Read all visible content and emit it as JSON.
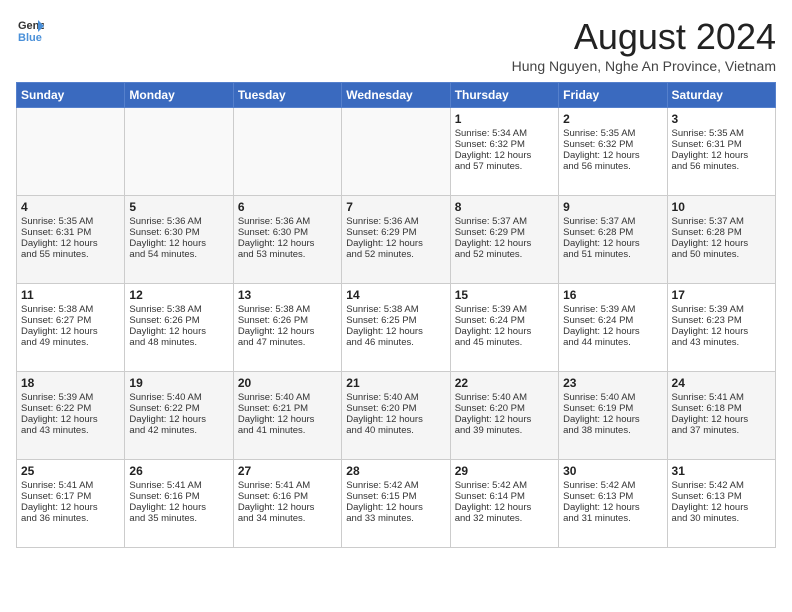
{
  "header": {
    "logo_line1": "General",
    "logo_line2": "Blue",
    "title": "August 2024",
    "subtitle": "Hung Nguyen, Nghe An Province, Vietnam"
  },
  "weekdays": [
    "Sunday",
    "Monday",
    "Tuesday",
    "Wednesday",
    "Thursday",
    "Friday",
    "Saturday"
  ],
  "weeks": [
    [
      {
        "day": "",
        "content": ""
      },
      {
        "day": "",
        "content": ""
      },
      {
        "day": "",
        "content": ""
      },
      {
        "day": "",
        "content": ""
      },
      {
        "day": "1",
        "content": "Sunrise: 5:34 AM\nSunset: 6:32 PM\nDaylight: 12 hours\nand 57 minutes."
      },
      {
        "day": "2",
        "content": "Sunrise: 5:35 AM\nSunset: 6:32 PM\nDaylight: 12 hours\nand 56 minutes."
      },
      {
        "day": "3",
        "content": "Sunrise: 5:35 AM\nSunset: 6:31 PM\nDaylight: 12 hours\nand 56 minutes."
      }
    ],
    [
      {
        "day": "4",
        "content": "Sunrise: 5:35 AM\nSunset: 6:31 PM\nDaylight: 12 hours\nand 55 minutes."
      },
      {
        "day": "5",
        "content": "Sunrise: 5:36 AM\nSunset: 6:30 PM\nDaylight: 12 hours\nand 54 minutes."
      },
      {
        "day": "6",
        "content": "Sunrise: 5:36 AM\nSunset: 6:30 PM\nDaylight: 12 hours\nand 53 minutes."
      },
      {
        "day": "7",
        "content": "Sunrise: 5:36 AM\nSunset: 6:29 PM\nDaylight: 12 hours\nand 52 minutes."
      },
      {
        "day": "8",
        "content": "Sunrise: 5:37 AM\nSunset: 6:29 PM\nDaylight: 12 hours\nand 52 minutes."
      },
      {
        "day": "9",
        "content": "Sunrise: 5:37 AM\nSunset: 6:28 PM\nDaylight: 12 hours\nand 51 minutes."
      },
      {
        "day": "10",
        "content": "Sunrise: 5:37 AM\nSunset: 6:28 PM\nDaylight: 12 hours\nand 50 minutes."
      }
    ],
    [
      {
        "day": "11",
        "content": "Sunrise: 5:38 AM\nSunset: 6:27 PM\nDaylight: 12 hours\nand 49 minutes."
      },
      {
        "day": "12",
        "content": "Sunrise: 5:38 AM\nSunset: 6:26 PM\nDaylight: 12 hours\nand 48 minutes."
      },
      {
        "day": "13",
        "content": "Sunrise: 5:38 AM\nSunset: 6:26 PM\nDaylight: 12 hours\nand 47 minutes."
      },
      {
        "day": "14",
        "content": "Sunrise: 5:38 AM\nSunset: 6:25 PM\nDaylight: 12 hours\nand 46 minutes."
      },
      {
        "day": "15",
        "content": "Sunrise: 5:39 AM\nSunset: 6:24 PM\nDaylight: 12 hours\nand 45 minutes."
      },
      {
        "day": "16",
        "content": "Sunrise: 5:39 AM\nSunset: 6:24 PM\nDaylight: 12 hours\nand 44 minutes."
      },
      {
        "day": "17",
        "content": "Sunrise: 5:39 AM\nSunset: 6:23 PM\nDaylight: 12 hours\nand 43 minutes."
      }
    ],
    [
      {
        "day": "18",
        "content": "Sunrise: 5:39 AM\nSunset: 6:22 PM\nDaylight: 12 hours\nand 43 minutes."
      },
      {
        "day": "19",
        "content": "Sunrise: 5:40 AM\nSunset: 6:22 PM\nDaylight: 12 hours\nand 42 minutes."
      },
      {
        "day": "20",
        "content": "Sunrise: 5:40 AM\nSunset: 6:21 PM\nDaylight: 12 hours\nand 41 minutes."
      },
      {
        "day": "21",
        "content": "Sunrise: 5:40 AM\nSunset: 6:20 PM\nDaylight: 12 hours\nand 40 minutes."
      },
      {
        "day": "22",
        "content": "Sunrise: 5:40 AM\nSunset: 6:20 PM\nDaylight: 12 hours\nand 39 minutes."
      },
      {
        "day": "23",
        "content": "Sunrise: 5:40 AM\nSunset: 6:19 PM\nDaylight: 12 hours\nand 38 minutes."
      },
      {
        "day": "24",
        "content": "Sunrise: 5:41 AM\nSunset: 6:18 PM\nDaylight: 12 hours\nand 37 minutes."
      }
    ],
    [
      {
        "day": "25",
        "content": "Sunrise: 5:41 AM\nSunset: 6:17 PM\nDaylight: 12 hours\nand 36 minutes."
      },
      {
        "day": "26",
        "content": "Sunrise: 5:41 AM\nSunset: 6:16 PM\nDaylight: 12 hours\nand 35 minutes."
      },
      {
        "day": "27",
        "content": "Sunrise: 5:41 AM\nSunset: 6:16 PM\nDaylight: 12 hours\nand 34 minutes."
      },
      {
        "day": "28",
        "content": "Sunrise: 5:42 AM\nSunset: 6:15 PM\nDaylight: 12 hours\nand 33 minutes."
      },
      {
        "day": "29",
        "content": "Sunrise: 5:42 AM\nSunset: 6:14 PM\nDaylight: 12 hours\nand 32 minutes."
      },
      {
        "day": "30",
        "content": "Sunrise: 5:42 AM\nSunset: 6:13 PM\nDaylight: 12 hours\nand 31 minutes."
      },
      {
        "day": "31",
        "content": "Sunrise: 5:42 AM\nSunset: 6:13 PM\nDaylight: 12 hours\nand 30 minutes."
      }
    ]
  ]
}
